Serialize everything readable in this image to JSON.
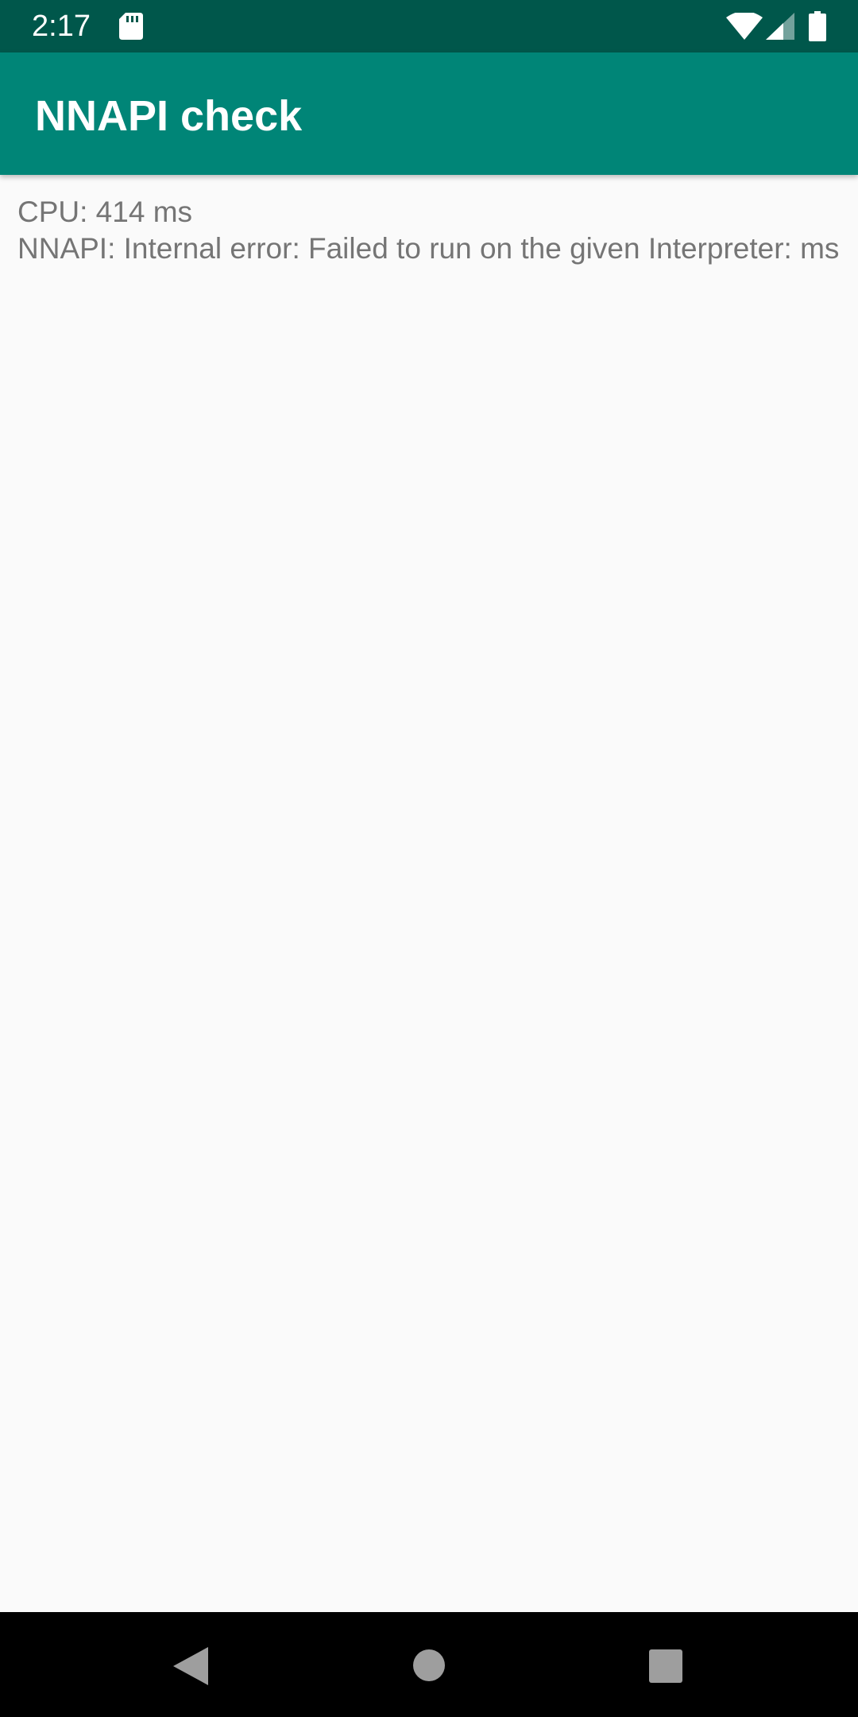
{
  "status_bar": {
    "time": "2:17",
    "icons": [
      "sd-card-icon",
      "wifi-icon",
      "cell-signal-icon",
      "battery-icon"
    ]
  },
  "app_bar": {
    "title": "NNAPI check"
  },
  "results": {
    "cpu_line": "CPU: 414 ms",
    "nnapi_line": "NNAPI: Internal error: Failed to run on the given Interpreter: ms"
  },
  "navigation": {
    "icons": [
      "back-icon",
      "home-icon",
      "recents-icon"
    ]
  },
  "colors": {
    "status_bar": "#00574b",
    "app_bar": "#008577",
    "background": "#fafafa",
    "text": "#757575",
    "nav_bar": "#000000"
  }
}
